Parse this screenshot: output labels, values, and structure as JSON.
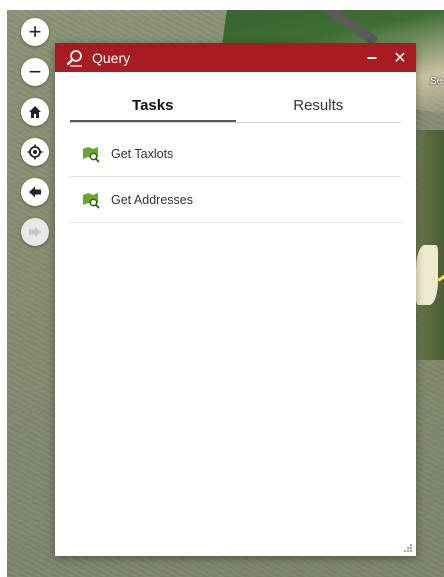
{
  "map": {
    "label": "Se"
  },
  "nav": {
    "zoom_in": "+",
    "zoom_out": "−"
  },
  "panel": {
    "title": "Query",
    "minimize_label": "–",
    "close_label": "✕",
    "tabs": [
      {
        "label": "Tasks",
        "active": true
      },
      {
        "label": "Results",
        "active": false
      }
    ],
    "tasks": [
      {
        "label": "Get Taxlots",
        "icon": "map-query-icon"
      },
      {
        "label": "Get Addresses",
        "icon": "map-query-icon"
      }
    ]
  },
  "colors": {
    "header": "#a81b23",
    "task_icon": "#6aa62d"
  }
}
